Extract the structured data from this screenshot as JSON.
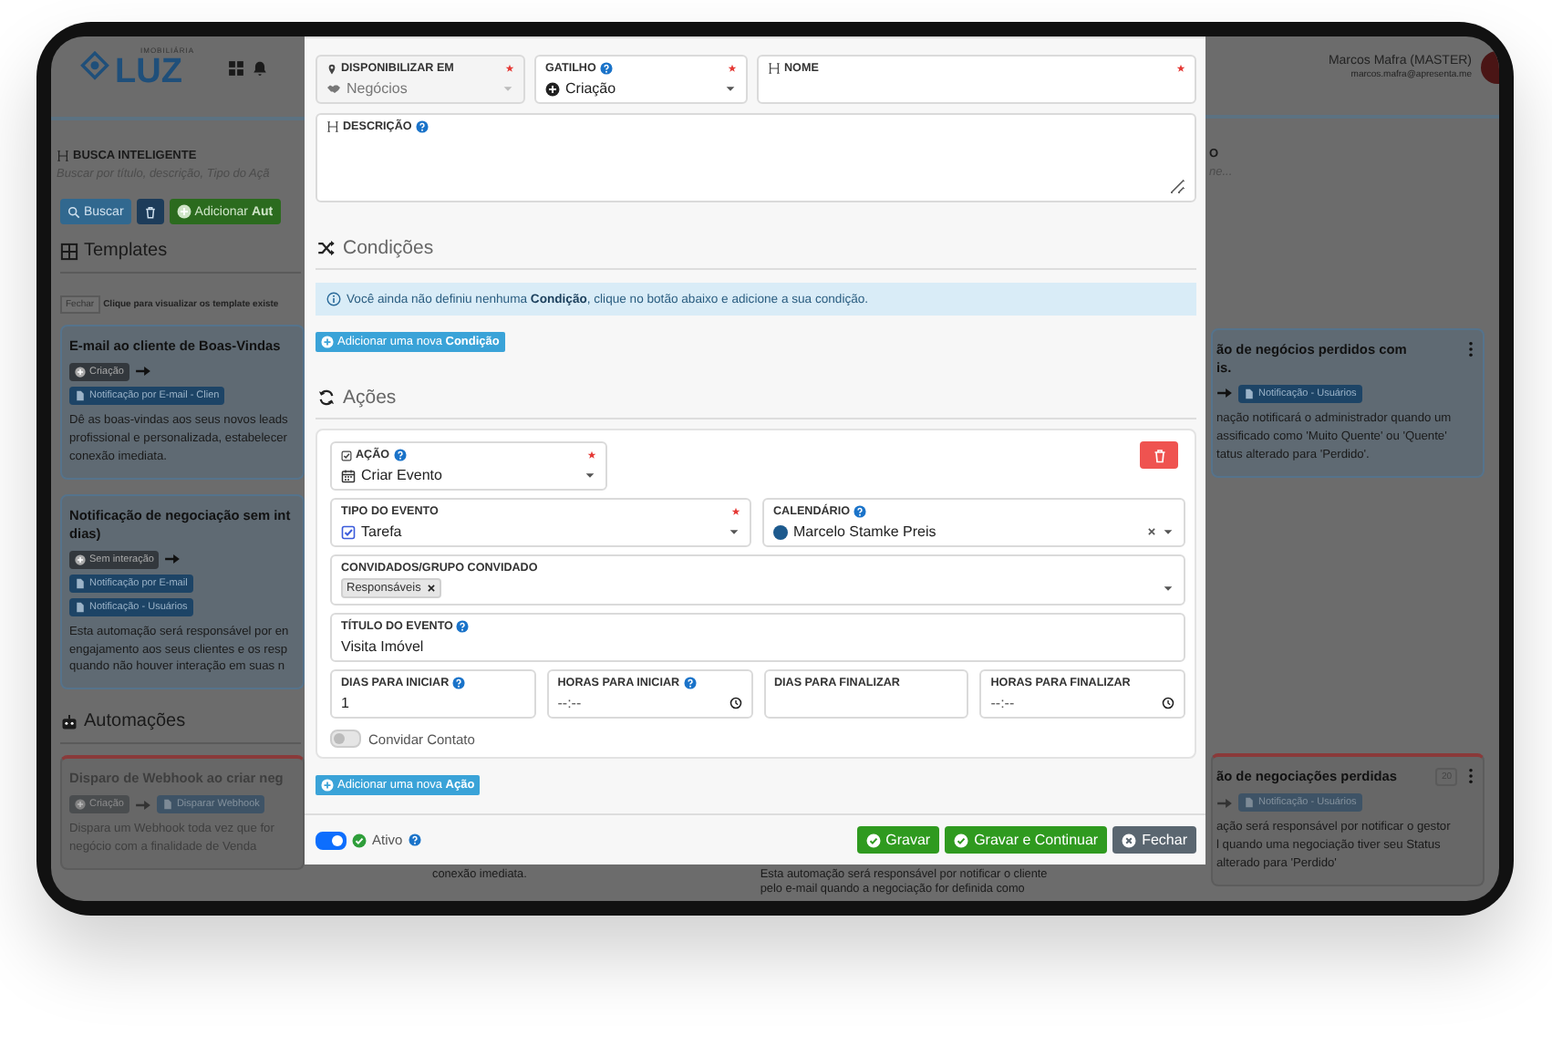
{
  "header": {
    "logo_small": "IMOBILIÁRIA",
    "logo": "LUZ",
    "user_name": "Marcos Mafra (MASTER)",
    "user_email": "marcos.mafra@apresenta.me"
  },
  "search": {
    "label": "BUSCA INTELIGENTE",
    "placeholder": "Buscar por título, descrição, Tipo do Açã",
    "button": "Buscar",
    "add_button": "Adicionar **Aut**"
  },
  "right_filter": {
    "label": "O",
    "placeholder": "ne..."
  },
  "templates": {
    "title": "Templates",
    "hint_button": "Fechar",
    "hint": "Clique para visualizar os template existe"
  },
  "template_cards": [
    {
      "title_lines": [
        "E-mail ao cliente de Boas-Vindas"
      ],
      "flow": [
        {
          "kind": "trigger",
          "label": "Criação"
        },
        {
          "kind": "arrow"
        },
        {
          "kind": "action",
          "label": "Notificação por E-mail - Clien"
        }
      ],
      "lines": [
        "Dê as boas-vindas aos seus novos leads",
        "profissional e personalizada, estabelecer",
        "conexão imediata."
      ]
    },
    {
      "title_lines": [
        "Notificação de negociação sem int",
        "dias)"
      ],
      "flow": [
        {
          "kind": "trigger",
          "label": "Sem interação"
        },
        {
          "kind": "arrow"
        },
        {
          "kind": "action",
          "label": "Notificação por E-mail"
        },
        {
          "kind": "action",
          "label": "Notificação - Usuários"
        }
      ],
      "lines": [
        "Esta automação será responsável por en",
        "engajamento aos seus clientes e os resp",
        "quando não houver interação em suas n"
      ]
    }
  ],
  "right_template_card": {
    "title_lines": [
      "ão de negócios perdidos com",
      "is."
    ],
    "flow": [
      {
        "kind": "arrow"
      },
      {
        "kind": "action",
        "label": "Notificação - Usuários"
      }
    ],
    "lines": [
      "nação notificará o administrador quando um",
      "assificado como 'Muito Quente' ou 'Quente'",
      "tatus alterado para 'Perdido'."
    ]
  },
  "automations": {
    "title": "Automações"
  },
  "automation_card": {
    "title_lines": [
      "Disparo de Webhook ao criar neg"
    ],
    "flow": [
      {
        "kind": "trigger",
        "label": "Criação"
      },
      {
        "kind": "arrow"
      },
      {
        "kind": "action",
        "label": "Disparar Webhook"
      }
    ],
    "lines": [
      "Dispara um Webhook toda vez que for",
      "negócio com a finalidade de Venda"
    ]
  },
  "right_automation_card": {
    "title_lines": [
      "ão de negociações perdidas"
    ],
    "badge": "20",
    "flow": [
      {
        "kind": "arrow"
      },
      {
        "kind": "action",
        "label": "Notificação - Usuários"
      }
    ],
    "lines": [
      "ação será responsável por notificar o gestor",
      "l quando uma negociação tiver seu Status",
      "alterado para 'Perdido'"
    ]
  },
  "under_modal_texts": [
    {
      "lines": [
        "conexão imediata."
      ]
    },
    {
      "lines": [
        "Esta automação será responsável por notificar o cliente",
        "pelo e-mail quando a negociação for definida como"
      ]
    }
  ],
  "modal": {
    "available": {
      "label": "DISPONIBILIZAR EM",
      "value": "Negócios",
      "required": true,
      "help": false,
      "disabled": true
    },
    "trigger": {
      "label": "GATILHO",
      "value": "Criação",
      "required": true,
      "help": true,
      "disabled": false
    },
    "name": {
      "label": "NOME",
      "required": true,
      "help": false
    },
    "description": {
      "label": "DESCRIÇÃO",
      "required": false,
      "help": true
    },
    "conditions": {
      "title": "Condições",
      "notice": "Você ainda não definiu nenhuma **Condição**, clique no botão abaixo e adicione a sua condição.",
      "add_button": "Adicionar uma nova **Condição**"
    },
    "actions": {
      "title": "Ações",
      "add_button": "Adicionar uma nova **Ação**",
      "items": [
        {
          "action": {
            "label": "AÇÃO",
            "value": "Criar Evento",
            "required": true,
            "help": true
          },
          "event_type": {
            "label": "TIPO DO EVENTO",
            "value": "Tarefa",
            "required": true,
            "help": false
          },
          "calendar": {
            "label": "CALENDÁRIO",
            "value": "Marcelo Stamke Preis",
            "color": "#1d5a8e",
            "required": false,
            "help": true
          },
          "guests": {
            "label": "CONVIDADOS/GRUPO CONVIDADO",
            "tags": [
              "Responsáveis"
            ]
          },
          "event_title": {
            "label": "TÍTULO DO EVENTO",
            "value": "Visita Imóvel",
            "help": true
          },
          "schedule": [
            {
              "label": "DIAS PARA INICIAR",
              "kind": "number",
              "value": "1",
              "help": true
            },
            {
              "label": "HORAS PARA INICIAR",
              "kind": "time",
              "placeholder": "--:--",
              "help": true
            },
            {
              "label": "DIAS PARA FINALIZAR",
              "kind": "number",
              "help": false
            },
            {
              "label": "HORAS PARA FINALIZAR",
              "kind": "time",
              "placeholder": "--:--",
              "help": false
            }
          ],
          "invite_contact": {
            "label": "Convidar Contato",
            "on": false
          }
        }
      ]
    },
    "footer": {
      "active": {
        "label": "Ativo",
        "on": true
      },
      "buttons": [
        {
          "label": "Gravar",
          "kind": "primary"
        },
        {
          "label": "Gravar e Continuar",
          "kind": "primary"
        },
        {
          "label": "Fechar",
          "kind": "secondary"
        }
      ]
    }
  }
}
